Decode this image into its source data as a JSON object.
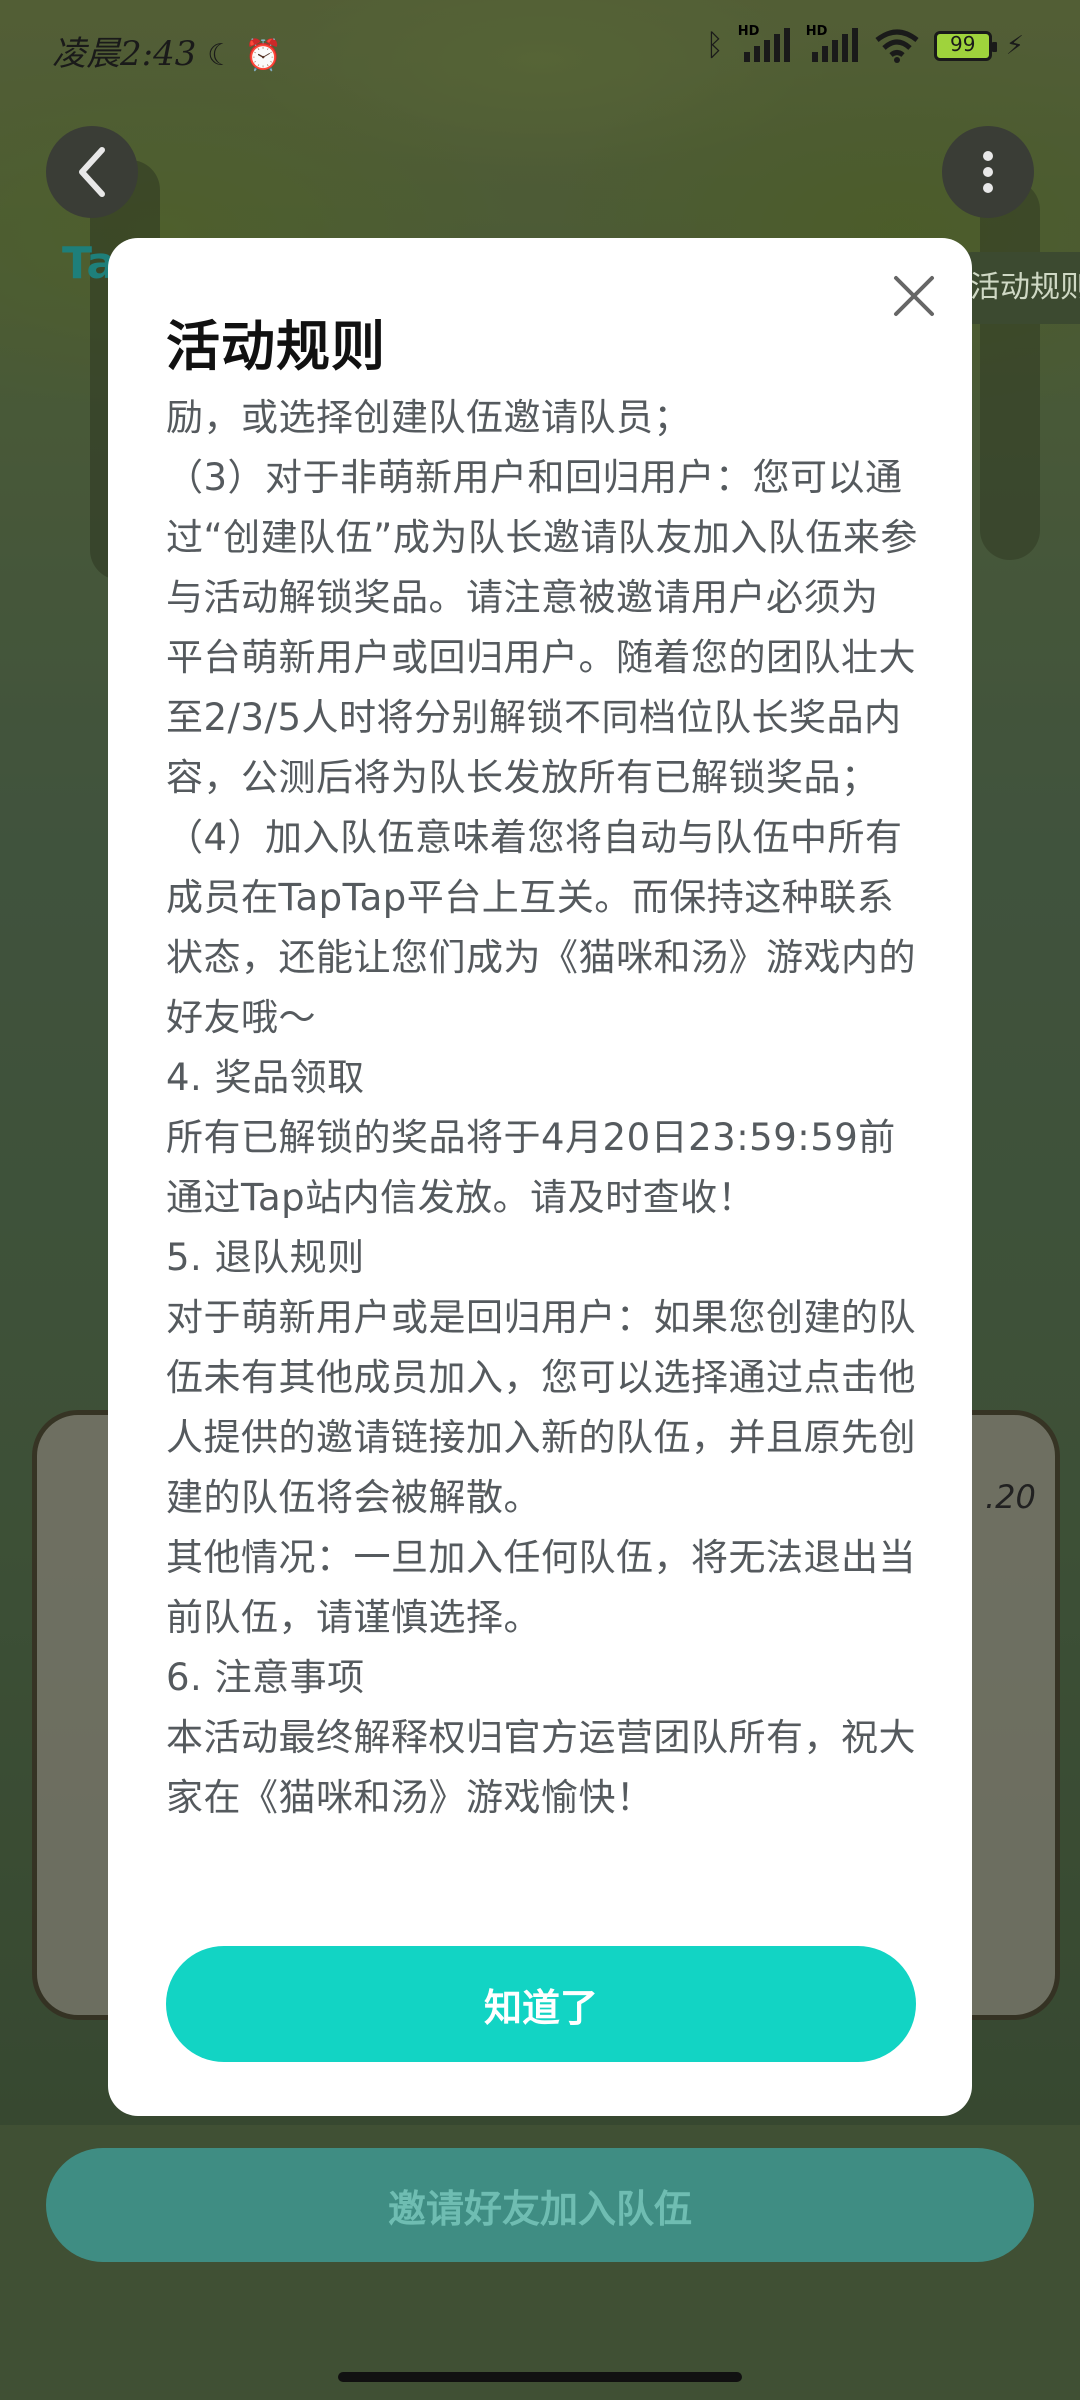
{
  "status_bar": {
    "time": "凌晨2:43",
    "moon_icon": "moon-icon",
    "alarm_icon": "alarm-icon",
    "bluetooth_icon": "bluetooth-icon",
    "signal_label_1": "HD",
    "signal_label_2": "HD",
    "wifi_icon": "wifi-icon",
    "battery_level": "99",
    "charging_icon": "bolt-icon"
  },
  "header": {
    "back_icon": "chevron-left-icon",
    "more_icon": "more-vertical-icon",
    "brand_partial": "Ta",
    "rules_tab_label": "活动规则"
  },
  "modal": {
    "title": "活动规则",
    "close_icon": "close-icon",
    "paragraphs": [
      "励，或选择创建队伍邀请队员；",
      "（3）对于非萌新用户和回归用户：您可以通过“创建队伍”成为队长邀请队友加入队伍来参与活动解锁奖品。请注意被邀请用户必须为 平台萌新用户或回归用户。随着您的团队壮大至2/3/5人时将分别解锁不同档位队长奖品内容，公测后将为队长发放所有已解锁奖品；",
      "（4）加入队伍意味着您将自动与队伍中所有成员在TapTap平台上互关。而保持这种联系状态，还能让您们成为《猫咪和汤》游戏内的好友哦～",
      "4. 奖品领取",
      "所有已解锁的奖品将于4月20日23:59:59前通过Tap站内信发放。请及时查收！",
      "5. 退队规则",
      "对于萌新用户或是回归用户：如果您创建的队伍未有其他成员加入，您可以选择通过点击他人提供的邀请链接加入新的队伍，并且原先创建的队伍将会被解散。",
      "其他情况：一旦加入任何队伍，将无法退出当前队伍，请谨慎选择。",
      "6. 注意事项",
      "本活动最终解释权归官方运营团队所有，祝大家在《猫咪和汤》游戏愉快！"
    ],
    "ok_button": "知道了"
  },
  "background": {
    "invite_button": "邀请好友加入队伍",
    "partial_date": ".20"
  },
  "colors": {
    "accent": "#12d4c4",
    "modal_bg": "#ffffff",
    "body_text": "#555a5e",
    "title_text": "#111111"
  }
}
